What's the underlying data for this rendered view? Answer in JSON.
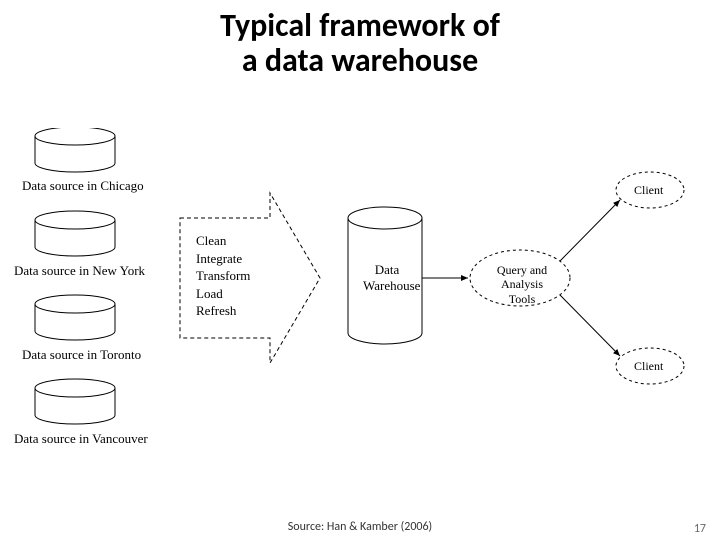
{
  "title_line1": "Typical framework of",
  "title_line2": "a data warehouse",
  "sources": {
    "s0": "Data source in Chicago",
    "s1": "Data source in New York",
    "s2": "Data source in Toronto",
    "s3": "Data source in Vancouver"
  },
  "etl_steps": {
    "e0": "Clean",
    "e1": "Integrate",
    "e2": "Transform",
    "e3": "Load",
    "e4": "Refresh"
  },
  "warehouse_label_l1": "Data",
  "warehouse_label_l2": "Warehouse",
  "tools_label_l1": "Query and",
  "tools_label_l2": "Analysis Tools",
  "client_label": "Client",
  "citation": "Source: Han & Kamber (2006)",
  "page_number": "17"
}
